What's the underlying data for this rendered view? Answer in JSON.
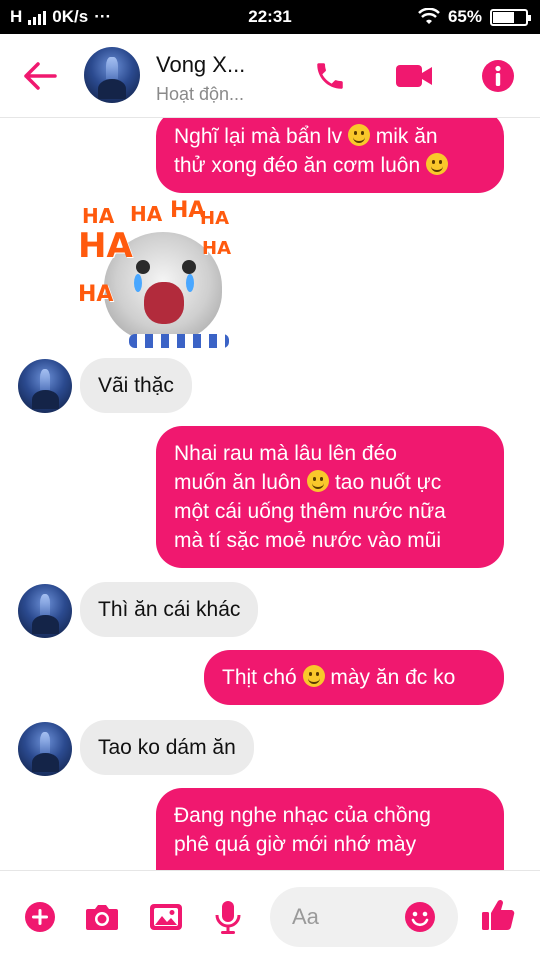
{
  "status_bar": {
    "network": "H",
    "speed": "0K/s",
    "more": "···",
    "time": "22:31",
    "battery_text": "65%",
    "battery_level": 0.65
  },
  "header": {
    "contact_name": "Vong X...",
    "contact_status": "Hoạt độn..."
  },
  "messages": [
    {
      "side": "out",
      "text_a": "Nghĩ lại mà bẩn lv ",
      "text_b": " mik ăn",
      "text_c": "thử xong đéo ăn cơm luôn "
    },
    {
      "side": "in",
      "kind": "sticker",
      "ha_text": "HA"
    },
    {
      "side": "in",
      "text": "Vãi thặc"
    },
    {
      "side": "out",
      "line1": "Nhai rau mà lâu lên đéo",
      "line2a": "muốn ăn luôn ",
      "line2b": " tao nuốt ực",
      "line3": "một cái uống thêm nước nữa",
      "line4": "mà tí sặc moẻ nước vào mũi"
    },
    {
      "side": "in",
      "text": "Thì ăn cái khác"
    },
    {
      "side": "out",
      "text_a": "Thịt chó ",
      "text_b": " mày ăn đc ko"
    },
    {
      "side": "in",
      "text": "Tao ko dám ăn"
    },
    {
      "side": "out",
      "line1": "Đang nghe nhạc của chồng",
      "line2": "phê quá giờ mới nhớ mày"
    }
  ],
  "composer": {
    "placeholder": "Aa"
  },
  "colors": {
    "accent": "#f0186f",
    "incoming_bubble": "#ebebeb",
    "header_text": "#111111",
    "muted": "#8a8a8a"
  },
  "icons": {
    "back": "arrow-left-icon",
    "call": "phone-icon",
    "video": "video-camera-icon",
    "info": "info-icon",
    "plus": "plus-icon",
    "camera": "camera-icon",
    "gallery": "image-icon",
    "mic": "microphone-icon",
    "emoji": "smiley-icon",
    "like": "thumbs-up-icon"
  }
}
